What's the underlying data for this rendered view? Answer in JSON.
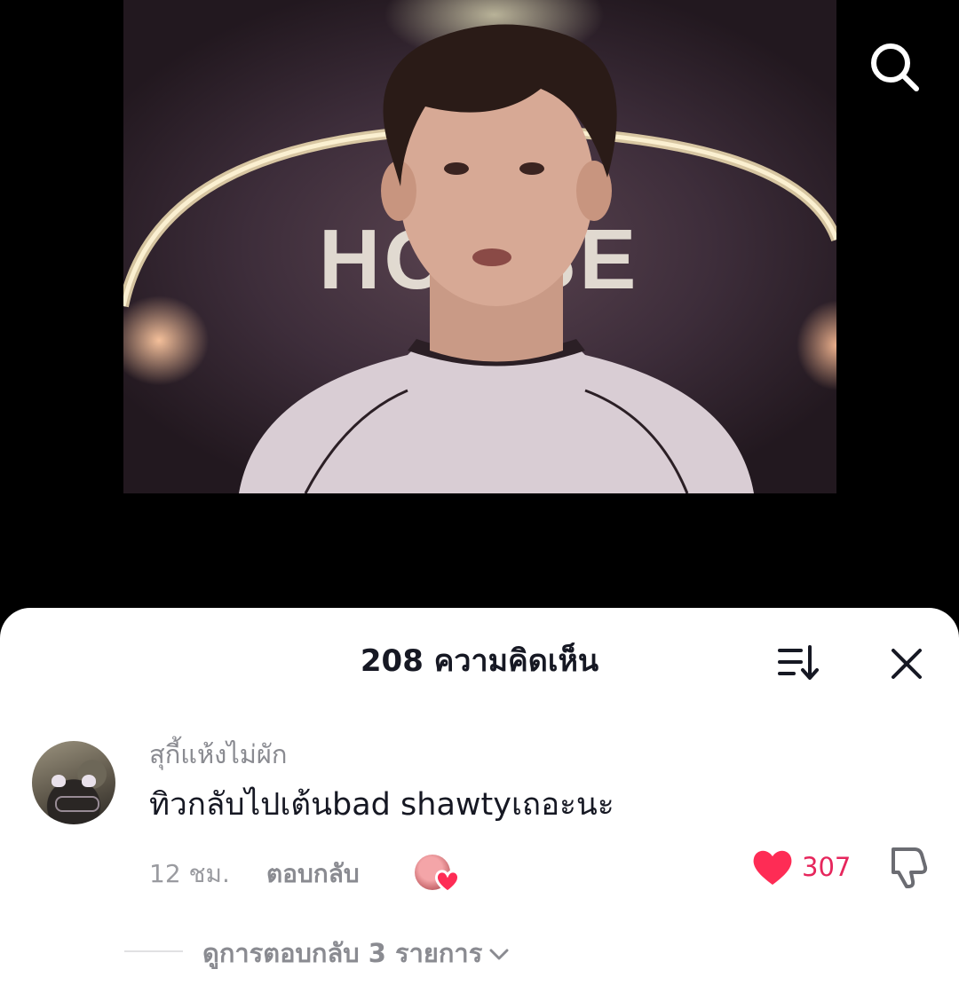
{
  "video": {
    "sign_text": "HOUSE"
  },
  "comments_sheet": {
    "title": "208 ความคิดเห็น"
  },
  "comment": {
    "username": "สุกี้แห้งไม่ผัก",
    "text": "ทิวกลับไปเต้นbad shawtyเถอะนะ",
    "time": "12 ชม.",
    "reply_label": "ตอบกลับ",
    "like_count": "307",
    "view_replies": "ดูการตอบกลับ 3 รายการ"
  },
  "colors": {
    "like": "#fe2c55",
    "sheet_bg": "#ffffff",
    "background": "#000000"
  },
  "icons": {
    "search": "search-icon",
    "sort": "sort-icon",
    "close": "close-icon",
    "like": "heart-icon",
    "dislike": "thumbs-down-icon",
    "expand": "chevron-down-icon"
  }
}
